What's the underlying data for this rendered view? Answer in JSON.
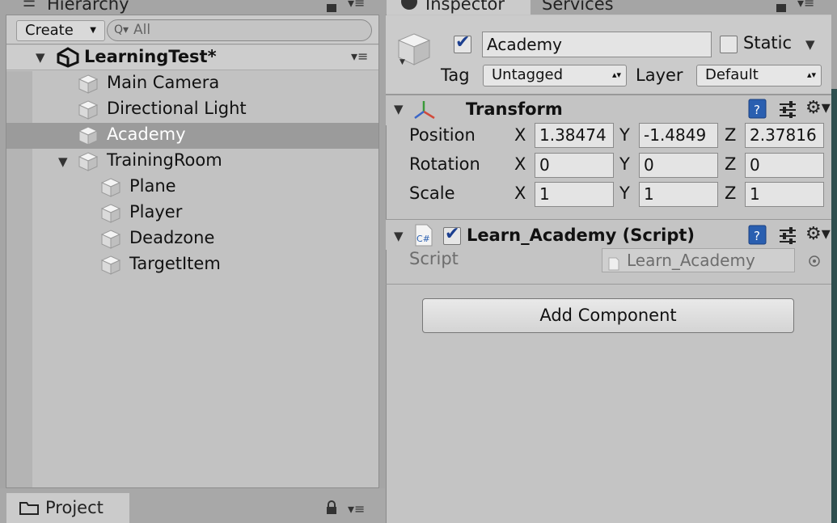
{
  "tabs": {
    "hierarchy": "Hierarchy",
    "inspector": "Inspector",
    "services": "Services",
    "project": "Project"
  },
  "hierarchy": {
    "create_label": "Create",
    "search_placeholder": "All",
    "scene_name": "LearningTest*",
    "items": [
      {
        "label": "Main Camera",
        "depth": 0,
        "foldout": false,
        "selected": false
      },
      {
        "label": "Directional Light",
        "depth": 0,
        "foldout": false,
        "selected": false
      },
      {
        "label": "Academy",
        "depth": 0,
        "foldout": false,
        "selected": true
      },
      {
        "label": "TrainingRoom",
        "depth": 0,
        "foldout": true,
        "selected": false
      },
      {
        "label": "Plane",
        "depth": 1,
        "foldout": false,
        "selected": false
      },
      {
        "label": "Player",
        "depth": 1,
        "foldout": false,
        "selected": false
      },
      {
        "label": "Deadzone",
        "depth": 1,
        "foldout": false,
        "selected": false
      },
      {
        "label": "TargetItem",
        "depth": 1,
        "foldout": false,
        "selected": false
      }
    ]
  },
  "inspector": {
    "object_name": "Academy",
    "active": true,
    "static_label": "Static",
    "static_checked": false,
    "tag_label": "Tag",
    "tag_value": "Untagged",
    "layer_label": "Layer",
    "layer_value": "Default",
    "transform": {
      "title": "Transform",
      "position_label": "Position",
      "rotation_label": "Rotation",
      "scale_label": "Scale",
      "axis_x": "X",
      "axis_y": "Y",
      "axis_z": "Z",
      "position": {
        "x": "1.38474",
        "y": "-1.4849",
        "z": "2.37816"
      },
      "rotation": {
        "x": "0",
        "y": "0",
        "z": "0"
      },
      "scale": {
        "x": "1",
        "y": "1",
        "z": "1"
      }
    },
    "script_component": {
      "title": "Learn_Academy (Script)",
      "enabled": true,
      "script_label": "Script",
      "script_value": "Learn_Academy",
      "file_icon_text": "C#"
    },
    "add_component_label": "Add Component"
  },
  "colors": {
    "panel_bg": "#c2c2c2",
    "selection": "#9b9b9b",
    "checkmark": "#1c3f8f",
    "help_icon": "#2a5fb0"
  }
}
